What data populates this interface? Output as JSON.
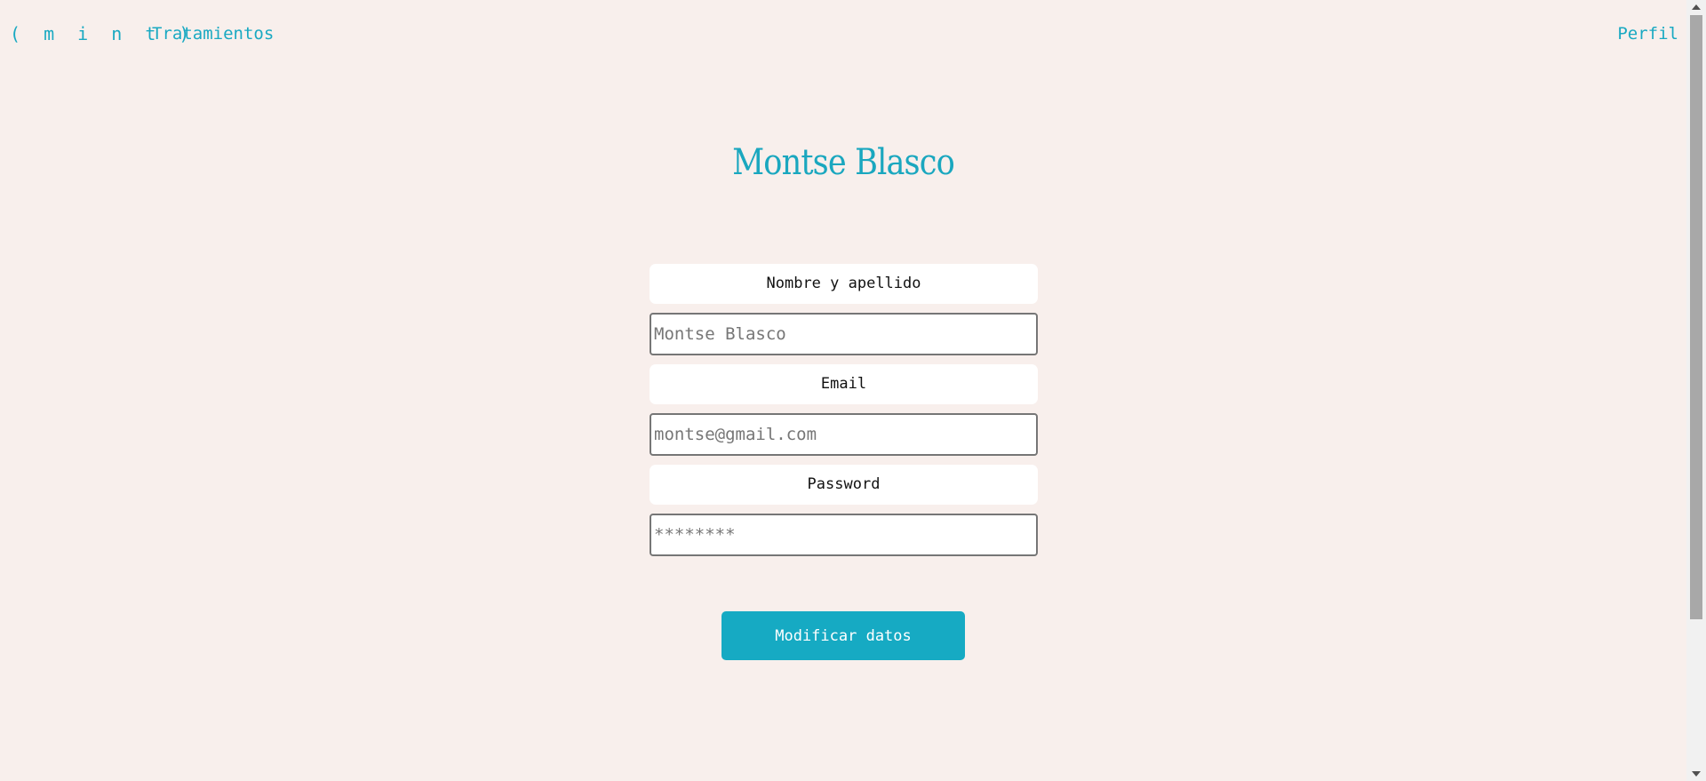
{
  "nav": {
    "logo": "( m i n t )",
    "treatments_link": "Tratamientos",
    "profile_link": "Perfil"
  },
  "profile": {
    "title": "Montse Blasco"
  },
  "form": {
    "name_label": "Nombre y apellido",
    "name_placeholder": "Montse Blasco",
    "email_label": "Email",
    "email_placeholder": "montse@gmail.com",
    "password_label": "Password",
    "password_placeholder": "********",
    "submit_label": "Modificar datos"
  },
  "colors": {
    "accent": "#19a9c2",
    "background": "#f8efec"
  }
}
